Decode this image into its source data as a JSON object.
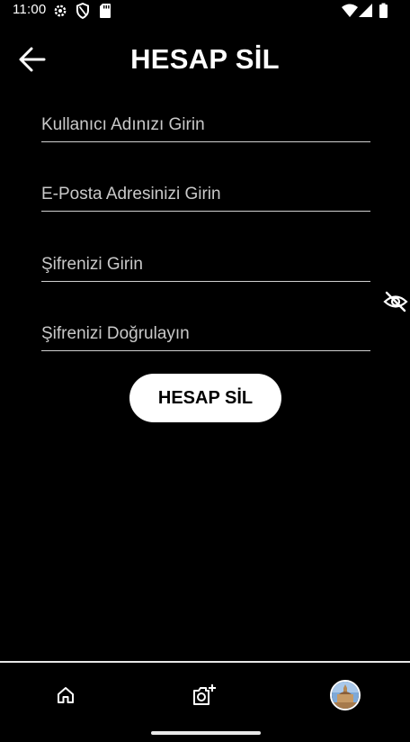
{
  "status_bar": {
    "time": "11:00",
    "icons": [
      "settings-icon",
      "shield-icon",
      "sd-card-icon",
      "wifi-icon",
      "cellular-signal-icon",
      "battery-icon"
    ]
  },
  "header": {
    "title": "HESAP SİL",
    "back_icon": "arrow-left-icon"
  },
  "form": {
    "username_placeholder": "Kullanıcı Adınızı Girin",
    "email_placeholder": "E-Posta Adresinizi Girin",
    "password_placeholder": "Şifrenizi Girin",
    "confirm_password_placeholder": "Şifrenizi Doğrulayın",
    "visibility_icon": "eye-off-icon",
    "submit_label": "HESAP SİL"
  },
  "bottom_nav": {
    "items": [
      "home-icon",
      "add-photo-icon",
      "profile-avatar"
    ]
  },
  "colors": {
    "background": "#000000",
    "text": "#ffffff",
    "button_bg": "#ffffff",
    "button_text": "#000000",
    "field_line": "#d0d0d0"
  }
}
